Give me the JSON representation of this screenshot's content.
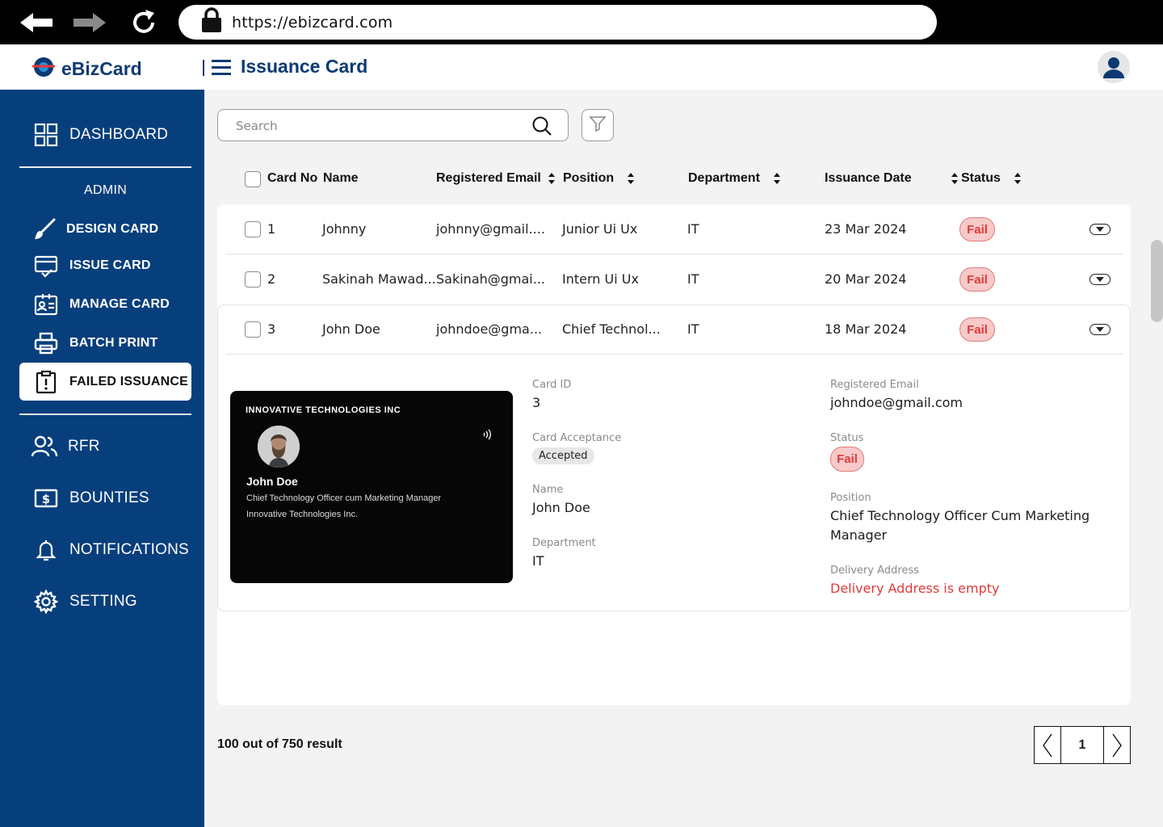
{
  "browser": {
    "url": "https://ebizcard.com"
  },
  "header": {
    "brand": "eBizCard",
    "title": "Issuance Card"
  },
  "sidebar": {
    "dashboard": "DASHBOARD",
    "section_label": "ADMIN",
    "items": [
      {
        "label": "DESIGN CARD",
        "icon": "brush-icon"
      },
      {
        "label": "ISSUE CARD",
        "icon": "card-check-icon"
      },
      {
        "label": "MANAGE CARD",
        "icon": "id-card-icon"
      },
      {
        "label": "BATCH PRINT",
        "icon": "printer-icon"
      },
      {
        "label": "FAILED ISSUANCE",
        "icon": "alert-clipboard-icon"
      }
    ],
    "bottom_items": [
      {
        "label": "RFR",
        "icon": "users-icon"
      },
      {
        "label": "BOUNTIES",
        "icon": "dollar-card-icon"
      },
      {
        "label": "NOTIFICATIONS",
        "icon": "bell-icon"
      },
      {
        "label": "SETTING",
        "icon": "gear-icon"
      }
    ]
  },
  "search": {
    "placeholder": "Search"
  },
  "table": {
    "columns": [
      "Card No",
      "Name",
      "Registered Email",
      "Position",
      "Department",
      "Issuance Date",
      "Status"
    ],
    "rows": [
      {
        "card_no": "1",
        "name": "Johnny",
        "email": "johnny@gmail....",
        "position": "Junior Ui Ux",
        "department": "IT",
        "date": "23 Mar 2024",
        "status": "Fail"
      },
      {
        "card_no": "2",
        "name": "Sakinah Mawad...",
        "email": "Sakinah@gmai...",
        "position": "Intern Ui Ux",
        "department": "IT",
        "date": "20 Mar 2024",
        "status": "Fail"
      },
      {
        "card_no": "3",
        "name": "John Doe",
        "email": "johndoe@gma...",
        "position": "Chief Technol...",
        "department": "IT",
        "date": "18 Mar 2024",
        "status": "Fail"
      }
    ]
  },
  "card_preview": {
    "company": "INNOVATIVE TECHNOLOGIES INC",
    "name": "John Doe",
    "title_line": "Chief Technology Officer cum Marketing Manager",
    "company_line": "Innovative Technologies Inc."
  },
  "details": {
    "card_id_label": "Card ID",
    "card_id": "3",
    "acceptance_label": "Card Acceptance",
    "acceptance": "Accepted",
    "name_label": "Name",
    "name": "John Doe",
    "department_label": "Department",
    "department": "IT",
    "email_label": "Registered Email",
    "email": "johndoe@gmail.com",
    "status_label": "Status",
    "status": "Fail",
    "position_label": "Position",
    "position": "Chief Technology Officer Cum Marketing Manager",
    "address_label": "Delivery Address",
    "address": "Delivery Address is empty"
  },
  "footer": {
    "result": "100 out of 750 result",
    "page": "1"
  },
  "colors": {
    "brand": "#073f7c",
    "fail": "#e03a3a"
  }
}
